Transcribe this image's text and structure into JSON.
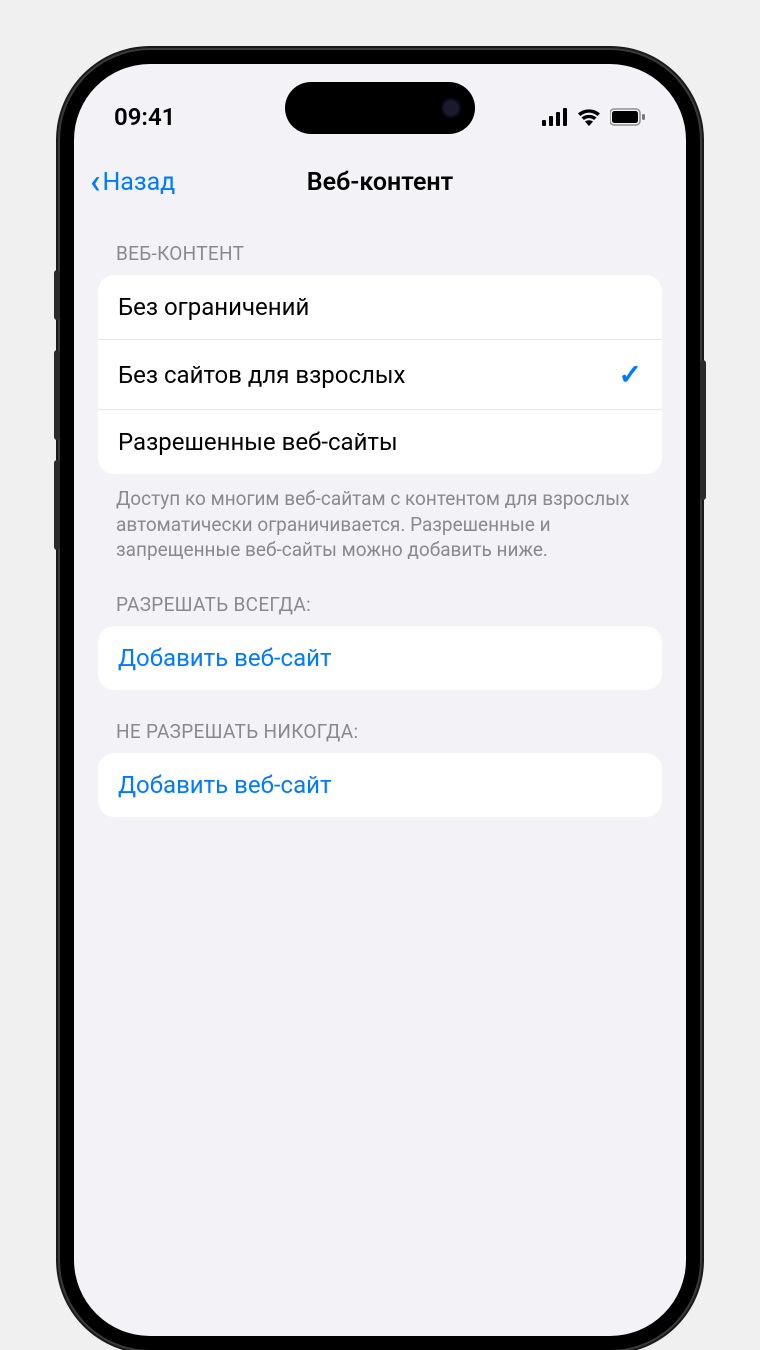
{
  "status": {
    "time": "09:41"
  },
  "nav": {
    "back_label": "Назад",
    "title": "Веб-контент"
  },
  "sections": {
    "web_content": {
      "header": "ВЕБ-КОНТЕНТ",
      "options": {
        "unrestricted": "Без ограничений",
        "limit_adult": "Без сайтов для взрослых",
        "allowed_only": "Разрешенные веб-сайты"
      },
      "footer": "Доступ ко многим веб-сайтам с контентом для взрослых автоматически ограничивается. Разрешенные и запрещенные веб-сайты можно добавить ниже.",
      "selected": "limit_adult"
    },
    "always_allow": {
      "header": "РАЗРЕШАТЬ ВСЕГДА:",
      "add_label": "Добавить веб-сайт"
    },
    "never_allow": {
      "header": "НЕ РАЗРЕШАТЬ НИКОГДА:",
      "add_label": "Добавить веб-сайт"
    }
  }
}
